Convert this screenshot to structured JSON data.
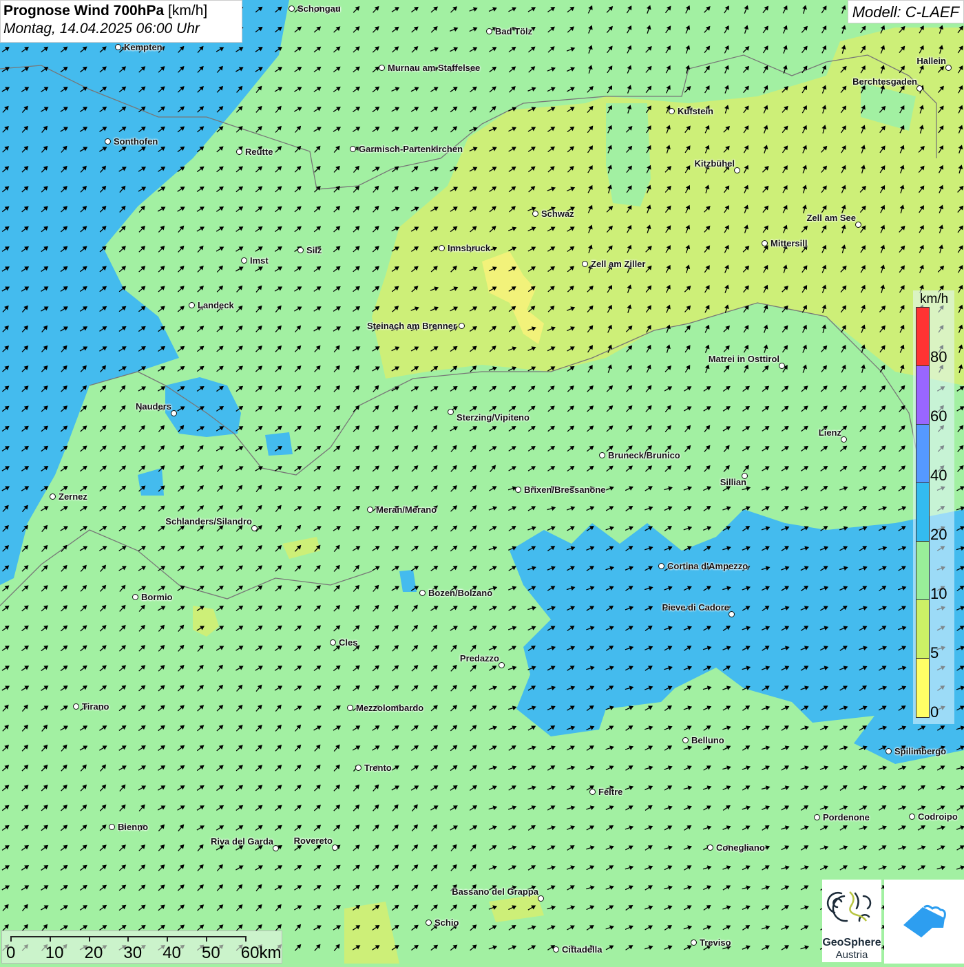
{
  "header": {
    "title": "Prognose Wind 700hPa",
    "unit": "[km/h]",
    "datetime": "Montag, 14.04.2025 06:00 Uhr",
    "model": "Modell: C-LAEF"
  },
  "legend": {
    "unit": "km/h",
    "labels": [
      "80",
      "60",
      "40",
      "20",
      "10",
      "5",
      "0"
    ],
    "colors": [
      "#ff3333",
      "#9966ff",
      "#5599ff",
      "#33bbf0",
      "#99ee99",
      "#ccf066",
      "#ffff66"
    ]
  },
  "map_colors": {
    "green": "#a2f0a2",
    "blue": "#44bbee",
    "lime": "#cdef78",
    "yellow": "#f2f27a"
  },
  "cities": [
    "Schongau",
    "Bad Tölz",
    "Kempten",
    "Murnau am Staffelsee",
    "Hallein",
    "Berchtesgaden",
    "Kufstein",
    "Sonthofen",
    "Reutte",
    "Garmisch-Partenkirchen",
    "Kitzbühel",
    "Schwaz",
    "Zell am See",
    "Mittersill",
    "Innsbruck",
    "Silz",
    "Imst",
    "Zell am Ziller",
    "Landeck",
    "Steinach am Brenner",
    "Matrei in Osttirol",
    "Nauders",
    "Sterzing/Vipiteno",
    "Lienz",
    "Bruneck/Brunico",
    "Sillian",
    "Brixen/Bressanone",
    "Zernez",
    "Meran/Merano",
    "Schlanders/Silandro",
    "Cortina d'Ampezzo",
    "Bozen/Bolzano",
    "Bormio",
    "Pieve di Cadore",
    "Cles",
    "Predazzo",
    "Tirano",
    "Mezzolombardo",
    "Belluno",
    "Spilimbergo",
    "Trento",
    "Feltre",
    "Pordenone",
    "Codroipo",
    "Bienno",
    "Riva del Garda",
    "Rovereto",
    "Conegliano",
    "Bassano del Grappa",
    "Schio",
    "Treviso",
    "Cittadella"
  ],
  "scale": {
    "ticks": [
      "0",
      "10",
      "20",
      "30",
      "40",
      "50",
      "60km"
    ]
  },
  "logos": {
    "geosphere_line1": "GeoSphere",
    "geosphere_line2": "Austria"
  }
}
